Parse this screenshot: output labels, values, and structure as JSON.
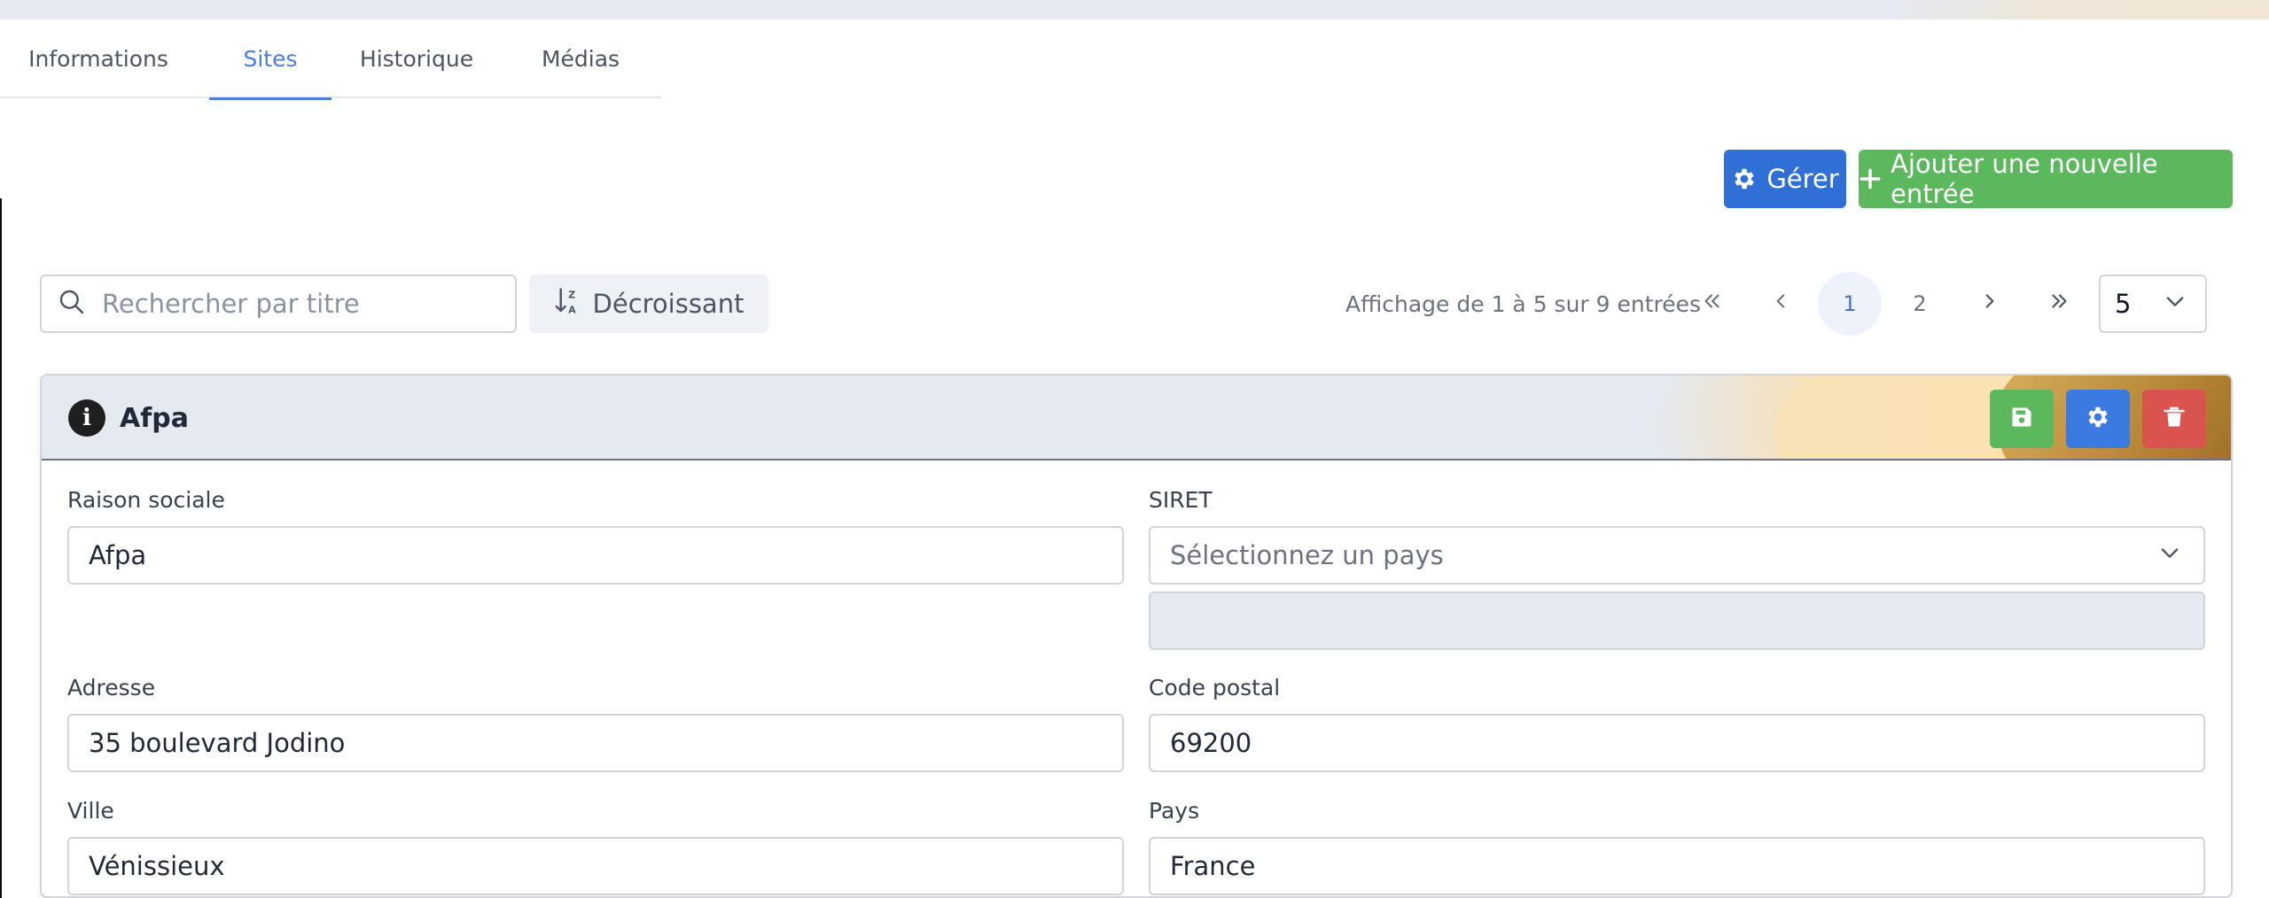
{
  "tabs": [
    {
      "label": "Informations"
    },
    {
      "label": "Sites"
    },
    {
      "label": "Historique"
    },
    {
      "label": "Médias"
    }
  ],
  "actions": {
    "manage_label": "Gérer",
    "add_label": "Ajouter une nouvelle entrée"
  },
  "toolbar": {
    "search_placeholder": "Rechercher par titre",
    "sort_label": "Décroissant",
    "page_info": "Affichage de 1 à 5 sur 9 entrées",
    "pages": [
      "1",
      "2"
    ],
    "per_page": "5"
  },
  "card": {
    "title": "Afpa",
    "fields": {
      "raison_sociale": {
        "label": "Raison sociale",
        "value": "Afpa"
      },
      "siret": {
        "label": "SIRET",
        "select_placeholder": "Sélectionnez un pays",
        "value": ""
      },
      "adresse": {
        "label": "Adresse",
        "value": "35 boulevard Jodino"
      },
      "code_postal": {
        "label": "Code postal",
        "value": "69200"
      },
      "ville": {
        "label": "Ville",
        "value": "Vénissieux"
      },
      "pays": {
        "label": "Pays",
        "value": "France"
      }
    }
  },
  "colors": {
    "accent": "#4a7ee0",
    "primary_button": "#2f6fd6",
    "success": "#5cb85c",
    "danger": "#d9534f"
  }
}
